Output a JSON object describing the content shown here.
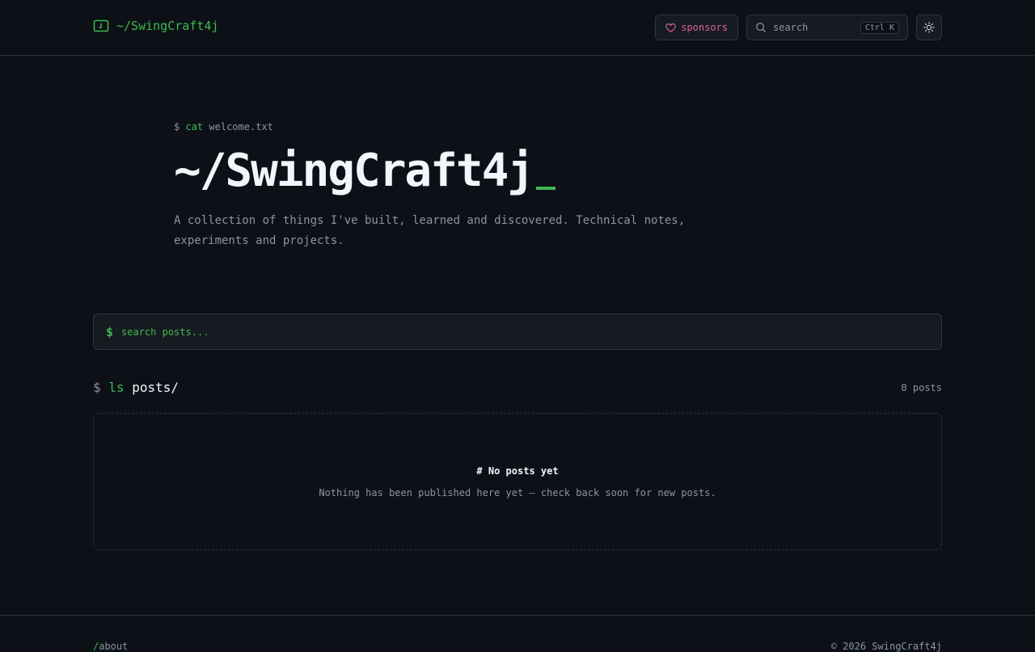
{
  "header": {
    "brand": "~/SwingCraft4j",
    "sponsors_label": "sponsors",
    "search_label": "search",
    "search_shortcut": "Ctrl K"
  },
  "hero": {
    "prompt": "$",
    "command": "cat",
    "argument": "welcome.txt",
    "title": "~/SwingCraft4j",
    "description": "A collection of things I've built, learned and discovered. Technical notes, experiments and projects."
  },
  "post_search": {
    "prompt": "$",
    "placeholder": "search posts..."
  },
  "posts": {
    "prompt": "$",
    "command": "ls",
    "path": "posts/",
    "count": "0 posts",
    "empty_title": "# No posts yet",
    "empty_message": "Nothing has been published here yet — check back soon for new posts."
  },
  "footer": {
    "link_slash": "/",
    "link_label": "about",
    "copyright": "© 2026 SwingCraft4j"
  },
  "colors": {
    "background": "#0d1117",
    "accent": "#3fb950",
    "sponsor": "#db61a2",
    "border": "#30363d"
  }
}
